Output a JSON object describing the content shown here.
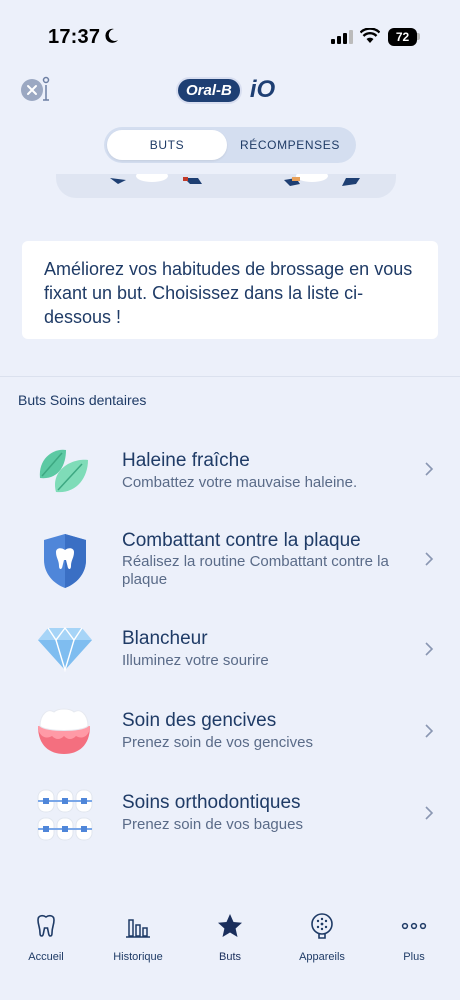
{
  "status": {
    "time": "17:37",
    "battery": "72"
  },
  "header": {
    "brand": "Oral-B",
    "product": "iO"
  },
  "segments": [
    {
      "label": "BUTS",
      "active": true
    },
    {
      "label": "RÉCOMPENSES",
      "active": false
    }
  ],
  "intro": "Améliorez vos habitudes de brossage en vous fixant un but. Choisissez dans la liste ci-dessous !",
  "section_title": "Buts Soins dentaires",
  "goals": [
    {
      "title": "Haleine fraîche",
      "subtitle": "Combattez votre mauvaise haleine.",
      "icon": "mint-leaves-icon"
    },
    {
      "title": "Combattant contre la plaque",
      "subtitle": "Réalisez la routine Combattant contre la plaque",
      "icon": "tooth-shield-icon"
    },
    {
      "title": "Blancheur",
      "subtitle": "Illuminez votre sourire",
      "icon": "diamond-icon"
    },
    {
      "title": "Soin des gencives",
      "subtitle": "Prenez soin de vos gencives",
      "icon": "gums-icon"
    },
    {
      "title": "Soins orthodontiques",
      "subtitle": "Prenez soin de vos bagues",
      "icon": "braces-icon"
    }
  ],
  "tabs": [
    {
      "label": "Accueil",
      "icon": "tooth-icon"
    },
    {
      "label": "Historique",
      "icon": "bar-chart-icon"
    },
    {
      "label": "Buts",
      "icon": "star-icon",
      "active": true
    },
    {
      "label": "Appareils",
      "icon": "brush-head-icon"
    },
    {
      "label": "Plus",
      "icon": "more-dots-icon"
    }
  ],
  "colors": {
    "background": "#ecf0fa",
    "primary": "#1f3b66",
    "brand": "#1e3f73"
  }
}
